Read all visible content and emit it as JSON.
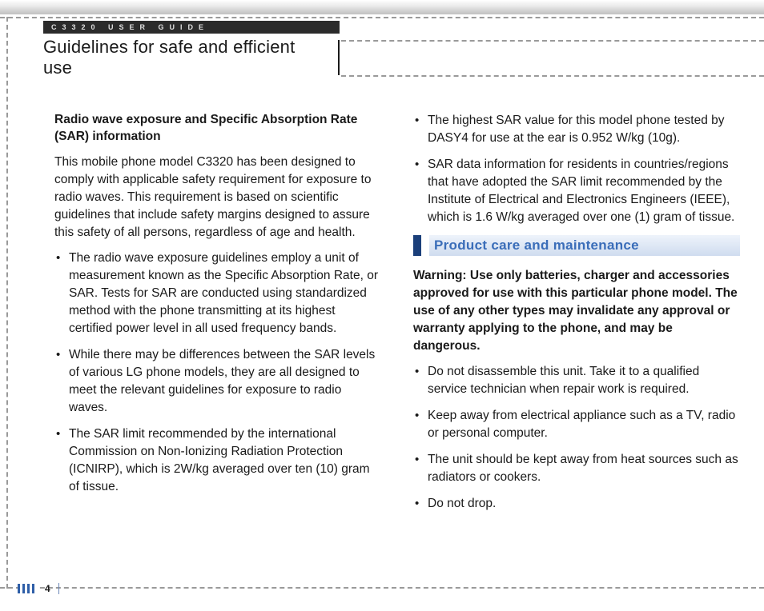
{
  "running_head": "C3320 USER GUIDE",
  "chapter_title": "Guidelines for safe and efficient use",
  "left_column": {
    "section_lead": "Radio wave exposure and Specific Absorption Rate (SAR) information",
    "intro_paragraph": "This mobile phone model C3320 has been designed to comply with applicable safety requirement for exposure to radio waves. This requirement is based on scientific guidelines that include safety margins designed to assure this safety of all persons, regardless of age and health.",
    "bullets": [
      "The radio wave exposure guidelines employ a unit of measurement known as the Specific Absorption Rate, or SAR. Tests for SAR are conducted using standardized method with the phone transmitting at its highest certified power level in all used frequency bands.",
      "While there may be differences between the SAR levels of various LG phone models, they are all designed to meet the relevant guidelines for exposure to radio waves.",
      "The SAR limit recommended by the international Commission on Non-Ionizing Radiation Protection (ICNIRP), which is 2W/kg averaged over ten (10) gram of tissue."
    ]
  },
  "right_column": {
    "top_bullets": [
      "The highest SAR value for this model phone tested by DASY4 for use at the ear is 0.952 W/kg (10g).",
      "SAR data information for residents in countries/regions that have adopted the SAR limit recommended by the Institute of Electrical and Electronics Engineers (IEEE), which is 1.6 W/kg averaged over one (1) gram of tissue."
    ],
    "section_heading": "Product care and maintenance",
    "warning": "Warning: Use only batteries, charger and accessories approved for use with this particular phone model. The use of any other types may invalidate any approval or warranty applying to the phone, and may be dangerous.",
    "care_bullets": [
      "Do not disassemble this unit. Take it to a qualified service technician when repair work is required.",
      "Keep away from electrical appliance such as a TV, radio or personal computer.",
      "The unit should be kept away from heat sources such as radiators or cookers.",
      "Do not drop."
    ]
  },
  "page_number": "4"
}
